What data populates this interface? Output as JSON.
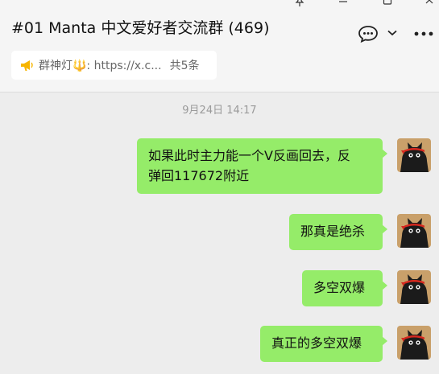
{
  "window_controls": [
    {
      "name": "pin-icon"
    },
    {
      "name": "minimize-icon"
    },
    {
      "name": "maximize-icon"
    },
    {
      "name": "close-icon"
    }
  ],
  "header": {
    "title": "#01 Manta 中文爱好者交流群 (469)",
    "chat_icon": "chat-bubble-icon",
    "dropdown_icon": "chevron-down-icon",
    "more_icon": "more-horizontal-icon"
  },
  "notice": {
    "icon": "megaphone-icon",
    "text": "群神灯🔱: https://x.c...",
    "count": "共5条"
  },
  "timestamp": "9月24日 14:17",
  "messages": [
    {
      "text_line1": "如果此时主力能一个V反画回去，反",
      "text_line2": "弹回117672附近"
    },
    {
      "text": "那真是绝杀"
    },
    {
      "text": "多空双爆"
    },
    {
      "text": "真正的多空双爆"
    }
  ],
  "colors": {
    "bubble": "#95ec69",
    "background": "#ededed",
    "header": "#f5f5f5",
    "notice_icon": "#f7b500"
  }
}
